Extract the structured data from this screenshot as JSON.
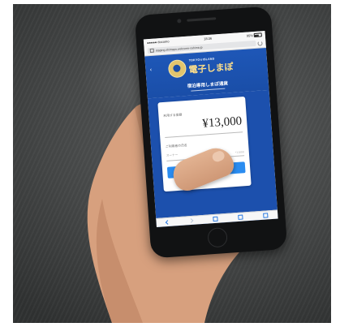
{
  "photo": {
    "subject": "hand holding smartphone"
  },
  "phone": {
    "status_bar": {
      "carrier": "●●●●● docomo",
      "time": "18:36",
      "battery": "95%"
    },
    "browser": {
      "url": "staging.shimapo.welcome-oshima.jp"
    },
    "app": {
      "logo_sub": "TOKYO☆ISLAND",
      "logo_main": "電子しまぽ",
      "page_title": "宿泊専用しまぽ通貨",
      "amount_label": "利用する金額",
      "amount_value": "¥13,000",
      "code_label": "ご利用者の氏名",
      "code_placeholder": "オーナー",
      "code_hint": "*11000",
      "pay_button_label": ""
    }
  },
  "colors": {
    "brand_blue": "#1c50ad",
    "button_blue": "#2a8cf0",
    "logo_gold": "#e2c56d"
  }
}
